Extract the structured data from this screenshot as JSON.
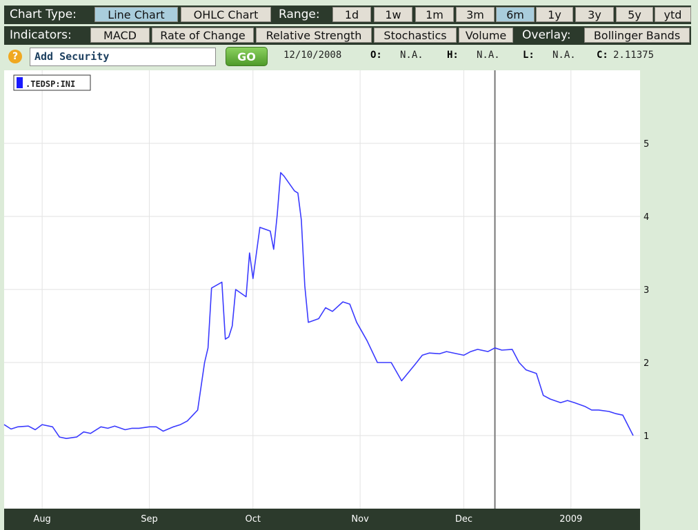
{
  "toolbar": {
    "chart_type_label": "Chart Type:",
    "chart_types": [
      {
        "label": "Line Chart",
        "selected": true
      },
      {
        "label": "OHLC Chart",
        "selected": false
      }
    ],
    "range_label": "Range:",
    "ranges": [
      {
        "label": "1d",
        "selected": false
      },
      {
        "label": "1w",
        "selected": false
      },
      {
        "label": "1m",
        "selected": false
      },
      {
        "label": "3m",
        "selected": false
      },
      {
        "label": "6m",
        "selected": true
      },
      {
        "label": "1y",
        "selected": false
      },
      {
        "label": "3y",
        "selected": false
      },
      {
        "label": "5y",
        "selected": false
      },
      {
        "label": "ytd",
        "selected": false
      }
    ],
    "indicators_label": "Indicators:",
    "indicators": [
      "MACD",
      "Rate of Change",
      "Relative Strength",
      "Stochastics",
      "Volume"
    ],
    "overlay_label": "Overlay:",
    "overlays": [
      "Bollinger Bands"
    ]
  },
  "search": {
    "help_label": "?",
    "value": "Add Security",
    "go_label": "GO"
  },
  "quote": {
    "date": "12/10/2008",
    "o_label": "O:",
    "o_value": "N.A.",
    "h_label": "H:",
    "h_value": "N.A.",
    "l_label": "L:",
    "l_value": "N.A.",
    "c_label": "C:",
    "c_value": "2.11375"
  },
  "colors": {
    "line": "#3a3aff",
    "toolbar_bg": "#2c3a2c",
    "selected_button": "#a9cddc",
    "page_bg": "#dcebd8"
  },
  "chart_data": {
    "type": "line",
    "legend": ".TEDSP:INI",
    "legend_position": "top-left",
    "ylim": [
      0,
      6
    ],
    "yticks": [
      1,
      2,
      3,
      4,
      5
    ],
    "xlim": [
      "2008-07-21",
      "2009-01-21"
    ],
    "xticks": [
      {
        "label": "Aug",
        "date": "2008-08-01"
      },
      {
        "label": "Sep",
        "date": "2008-09-01"
      },
      {
        "label": "Oct",
        "date": "2008-10-01"
      },
      {
        "label": "Nov",
        "date": "2008-11-01"
      },
      {
        "label": "Dec",
        "date": "2008-12-01"
      },
      {
        "label": "2009",
        "date": "2009-01-01"
      }
    ],
    "grid": true,
    "crosshair_date": "2008-12-10",
    "series": [
      {
        "name": ".TEDSP:INI",
        "x": [
          "2008-07-21",
          "2008-07-23",
          "2008-07-25",
          "2008-07-28",
          "2008-07-30",
          "2008-08-01",
          "2008-08-04",
          "2008-08-06",
          "2008-08-08",
          "2008-08-11",
          "2008-08-13",
          "2008-08-15",
          "2008-08-18",
          "2008-08-20",
          "2008-08-22",
          "2008-08-25",
          "2008-08-27",
          "2008-08-29",
          "2008-09-01",
          "2008-09-03",
          "2008-09-05",
          "2008-09-08",
          "2008-09-10",
          "2008-09-12",
          "2008-09-15",
          "2008-09-17",
          "2008-09-18",
          "2008-09-19",
          "2008-09-22",
          "2008-09-23",
          "2008-09-24",
          "2008-09-25",
          "2008-09-26",
          "2008-09-29",
          "2008-09-30",
          "2008-10-01",
          "2008-10-02",
          "2008-10-03",
          "2008-10-06",
          "2008-10-07",
          "2008-10-08",
          "2008-10-09",
          "2008-10-10",
          "2008-10-13",
          "2008-10-14",
          "2008-10-15",
          "2008-10-16",
          "2008-10-17",
          "2008-10-20",
          "2008-10-22",
          "2008-10-24",
          "2008-10-27",
          "2008-10-29",
          "2008-10-31",
          "2008-11-03",
          "2008-11-06",
          "2008-11-10",
          "2008-11-13",
          "2008-11-17",
          "2008-11-19",
          "2008-11-21",
          "2008-11-24",
          "2008-11-26",
          "2008-12-01",
          "2008-12-03",
          "2008-12-05",
          "2008-12-08",
          "2008-12-10",
          "2008-12-12",
          "2008-12-15",
          "2008-12-17",
          "2008-12-19",
          "2008-12-22",
          "2008-12-24",
          "2008-12-26",
          "2008-12-29",
          "2008-12-31",
          "2009-01-02",
          "2009-01-05",
          "2009-01-07",
          "2009-01-09",
          "2009-01-12",
          "2009-01-14",
          "2009-01-16",
          "2009-01-19"
        ],
        "y": [
          1.15,
          1.09,
          1.12,
          1.13,
          1.08,
          1.15,
          1.12,
          0.98,
          0.96,
          0.98,
          1.05,
          1.03,
          1.12,
          1.1,
          1.13,
          1.08,
          1.1,
          1.1,
          1.12,
          1.12,
          1.06,
          1.12,
          1.15,
          1.2,
          1.35,
          2.0,
          2.2,
          3.02,
          3.1,
          2.32,
          2.35,
          2.5,
          3.0,
          2.9,
          3.5,
          3.15,
          3.5,
          3.85,
          3.8,
          3.55,
          4.02,
          4.6,
          4.55,
          4.35,
          4.32,
          3.95,
          3.05,
          2.55,
          2.6,
          2.75,
          2.7,
          2.83,
          2.8,
          2.55,
          2.3,
          2.0,
          2.0,
          1.75,
          1.98,
          2.1,
          2.13,
          2.12,
          2.15,
          2.1,
          2.15,
          2.18,
          2.15,
          2.2,
          2.17,
          2.18,
          2.0,
          1.9,
          1.85,
          1.55,
          1.5,
          1.45,
          1.48,
          1.45,
          1.4,
          1.35,
          1.35,
          1.33,
          1.3,
          1.28,
          1.0
        ]
      }
    ]
  }
}
